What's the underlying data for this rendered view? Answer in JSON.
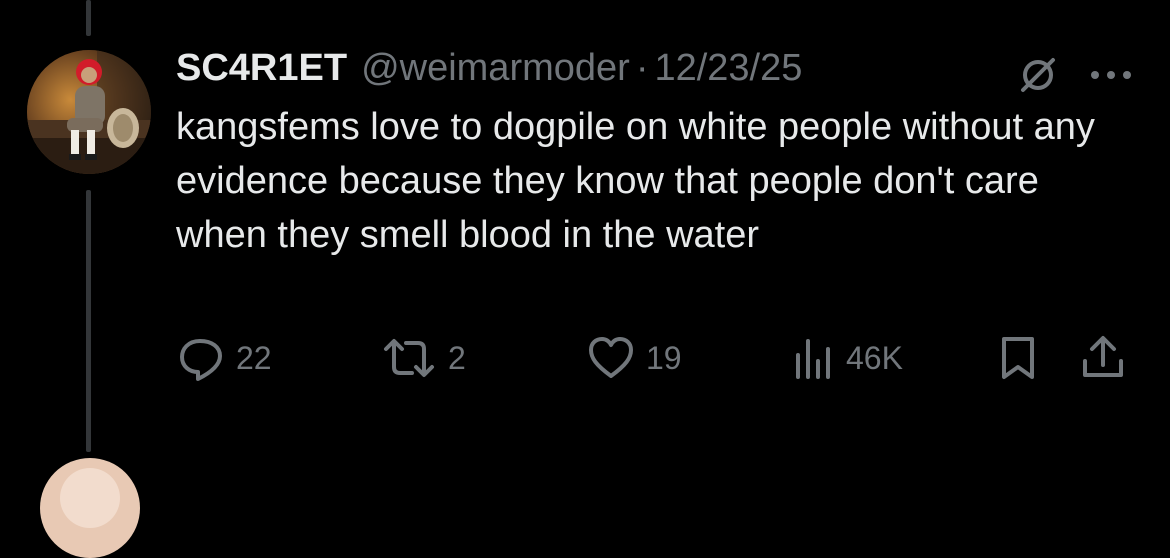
{
  "tweet": {
    "display_name": "SC4R1ET",
    "handle": "@weimarmoder",
    "separator": "·",
    "date": "12/23/25",
    "text": "kangsfems love to dogpile on white people without any evidence because they know that people don't care when they smell blood in the water",
    "avatar_icon": "profile-photo"
  },
  "actions": {
    "replies": "22",
    "reposts": "2",
    "likes": "19",
    "views": "46K"
  },
  "colors": {
    "background": "#000000",
    "primary_text": "#e7e9ea",
    "secondary_text": "#71767b",
    "thread_line": "#333639"
  }
}
